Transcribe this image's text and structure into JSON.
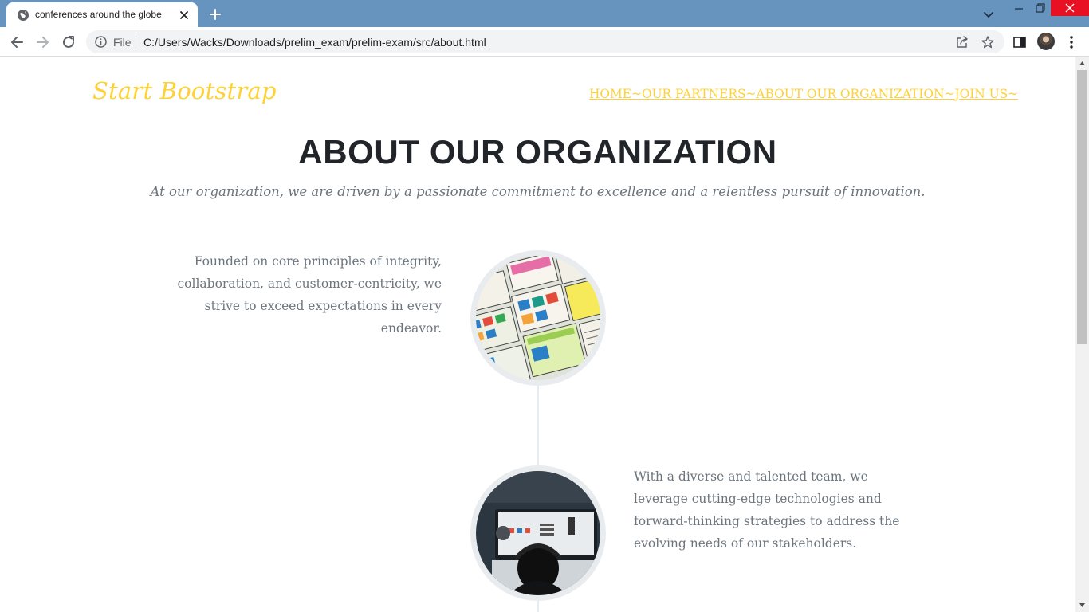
{
  "browser": {
    "tab_title": "conferences around the globe",
    "omnibox_scheme_label": "File",
    "omnibox_url": "C:/Users/Wacks/Downloads/prelim_exam/prelim-exam/src/about.html",
    "icons": {
      "favicon": "globe-icon",
      "tab_close": "close-icon",
      "new_tab": "plus-icon",
      "back": "arrow-left-icon",
      "forward": "arrow-right-icon",
      "reload": "reload-icon",
      "site_info": "info-icon",
      "share": "share-icon",
      "bookmark": "star-icon",
      "side_panel": "side-panel-icon",
      "profile": "avatar-icon",
      "menu": "kebab-menu-icon",
      "tab_search": "chevron-down-icon",
      "minimize": "minimize-icon",
      "restore": "restore-icon",
      "close_window": "close-icon"
    },
    "colors": {
      "tab_strip": "#6694bf",
      "window_close": "#e81123"
    }
  },
  "page": {
    "brand": "Start Bootstrap",
    "nav": {
      "home": "HOME",
      "partners": "OUR PARTNERS",
      "about": "ABOUT OUR ORGANIZATION",
      "join": "JOIN US",
      "separator": "~"
    },
    "heading": "ABOUT OUR ORGANIZATION",
    "subheading": "At our organization, we are driven by a passionate commitment to excellence and a relentless pursuit of innovation.",
    "timeline": [
      {
        "text": "Founded on core principles of integrity, collaboration, and customer-centricity, we strive to exceed expectations in every endeavor.",
        "image": "wireframe-sketches-image"
      },
      {
        "text": "With a diverse and talented team, we leverage cutting-edge technologies and forward-thinking strategies to address the evolving needs of our stakeholders.",
        "image": "person-at-computer-image"
      }
    ],
    "colors": {
      "accent": "#fed136",
      "heading": "#212529",
      "muted": "#6c757d",
      "timeline": "#e9ecef"
    }
  }
}
